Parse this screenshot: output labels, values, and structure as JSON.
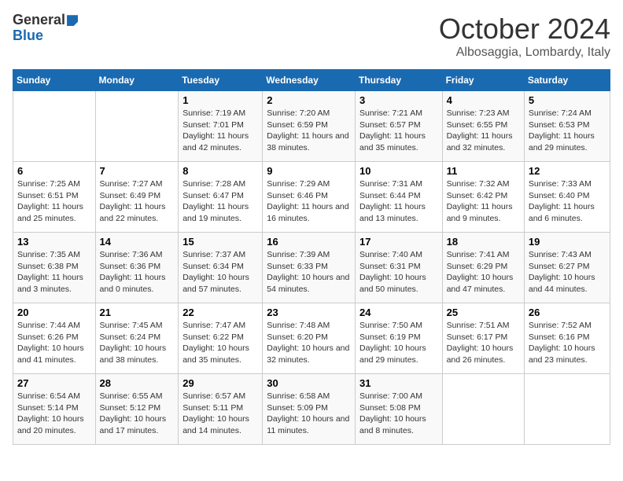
{
  "header": {
    "logo_general": "General",
    "logo_blue": "Blue",
    "title": "October 2024",
    "location": "Albosaggia, Lombardy, Italy"
  },
  "days_of_week": [
    "Sunday",
    "Monday",
    "Tuesday",
    "Wednesday",
    "Thursday",
    "Friday",
    "Saturday"
  ],
  "weeks": [
    [
      {
        "day": "",
        "content": ""
      },
      {
        "day": "",
        "content": ""
      },
      {
        "day": "1",
        "content": "Sunrise: 7:19 AM\nSunset: 7:01 PM\nDaylight: 11 hours and 42 minutes."
      },
      {
        "day": "2",
        "content": "Sunrise: 7:20 AM\nSunset: 6:59 PM\nDaylight: 11 hours and 38 minutes."
      },
      {
        "day": "3",
        "content": "Sunrise: 7:21 AM\nSunset: 6:57 PM\nDaylight: 11 hours and 35 minutes."
      },
      {
        "day": "4",
        "content": "Sunrise: 7:23 AM\nSunset: 6:55 PM\nDaylight: 11 hours and 32 minutes."
      },
      {
        "day": "5",
        "content": "Sunrise: 7:24 AM\nSunset: 6:53 PM\nDaylight: 11 hours and 29 minutes."
      }
    ],
    [
      {
        "day": "6",
        "content": "Sunrise: 7:25 AM\nSunset: 6:51 PM\nDaylight: 11 hours and 25 minutes."
      },
      {
        "day": "7",
        "content": "Sunrise: 7:27 AM\nSunset: 6:49 PM\nDaylight: 11 hours and 22 minutes."
      },
      {
        "day": "8",
        "content": "Sunrise: 7:28 AM\nSunset: 6:47 PM\nDaylight: 11 hours and 19 minutes."
      },
      {
        "day": "9",
        "content": "Sunrise: 7:29 AM\nSunset: 6:46 PM\nDaylight: 11 hours and 16 minutes."
      },
      {
        "day": "10",
        "content": "Sunrise: 7:31 AM\nSunset: 6:44 PM\nDaylight: 11 hours and 13 minutes."
      },
      {
        "day": "11",
        "content": "Sunrise: 7:32 AM\nSunset: 6:42 PM\nDaylight: 11 hours and 9 minutes."
      },
      {
        "day": "12",
        "content": "Sunrise: 7:33 AM\nSunset: 6:40 PM\nDaylight: 11 hours and 6 minutes."
      }
    ],
    [
      {
        "day": "13",
        "content": "Sunrise: 7:35 AM\nSunset: 6:38 PM\nDaylight: 11 hours and 3 minutes."
      },
      {
        "day": "14",
        "content": "Sunrise: 7:36 AM\nSunset: 6:36 PM\nDaylight: 11 hours and 0 minutes."
      },
      {
        "day": "15",
        "content": "Sunrise: 7:37 AM\nSunset: 6:34 PM\nDaylight: 10 hours and 57 minutes."
      },
      {
        "day": "16",
        "content": "Sunrise: 7:39 AM\nSunset: 6:33 PM\nDaylight: 10 hours and 54 minutes."
      },
      {
        "day": "17",
        "content": "Sunrise: 7:40 AM\nSunset: 6:31 PM\nDaylight: 10 hours and 50 minutes."
      },
      {
        "day": "18",
        "content": "Sunrise: 7:41 AM\nSunset: 6:29 PM\nDaylight: 10 hours and 47 minutes."
      },
      {
        "day": "19",
        "content": "Sunrise: 7:43 AM\nSunset: 6:27 PM\nDaylight: 10 hours and 44 minutes."
      }
    ],
    [
      {
        "day": "20",
        "content": "Sunrise: 7:44 AM\nSunset: 6:26 PM\nDaylight: 10 hours and 41 minutes."
      },
      {
        "day": "21",
        "content": "Sunrise: 7:45 AM\nSunset: 6:24 PM\nDaylight: 10 hours and 38 minutes."
      },
      {
        "day": "22",
        "content": "Sunrise: 7:47 AM\nSunset: 6:22 PM\nDaylight: 10 hours and 35 minutes."
      },
      {
        "day": "23",
        "content": "Sunrise: 7:48 AM\nSunset: 6:20 PM\nDaylight: 10 hours and 32 minutes."
      },
      {
        "day": "24",
        "content": "Sunrise: 7:50 AM\nSunset: 6:19 PM\nDaylight: 10 hours and 29 minutes."
      },
      {
        "day": "25",
        "content": "Sunrise: 7:51 AM\nSunset: 6:17 PM\nDaylight: 10 hours and 26 minutes."
      },
      {
        "day": "26",
        "content": "Sunrise: 7:52 AM\nSunset: 6:16 PM\nDaylight: 10 hours and 23 minutes."
      }
    ],
    [
      {
        "day": "27",
        "content": "Sunrise: 6:54 AM\nSunset: 5:14 PM\nDaylight: 10 hours and 20 minutes."
      },
      {
        "day": "28",
        "content": "Sunrise: 6:55 AM\nSunset: 5:12 PM\nDaylight: 10 hours and 17 minutes."
      },
      {
        "day": "29",
        "content": "Sunrise: 6:57 AM\nSunset: 5:11 PM\nDaylight: 10 hours and 14 minutes."
      },
      {
        "day": "30",
        "content": "Sunrise: 6:58 AM\nSunset: 5:09 PM\nDaylight: 10 hours and 11 minutes."
      },
      {
        "day": "31",
        "content": "Sunrise: 7:00 AM\nSunset: 5:08 PM\nDaylight: 10 hours and 8 minutes."
      },
      {
        "day": "",
        "content": ""
      },
      {
        "day": "",
        "content": ""
      }
    ]
  ]
}
